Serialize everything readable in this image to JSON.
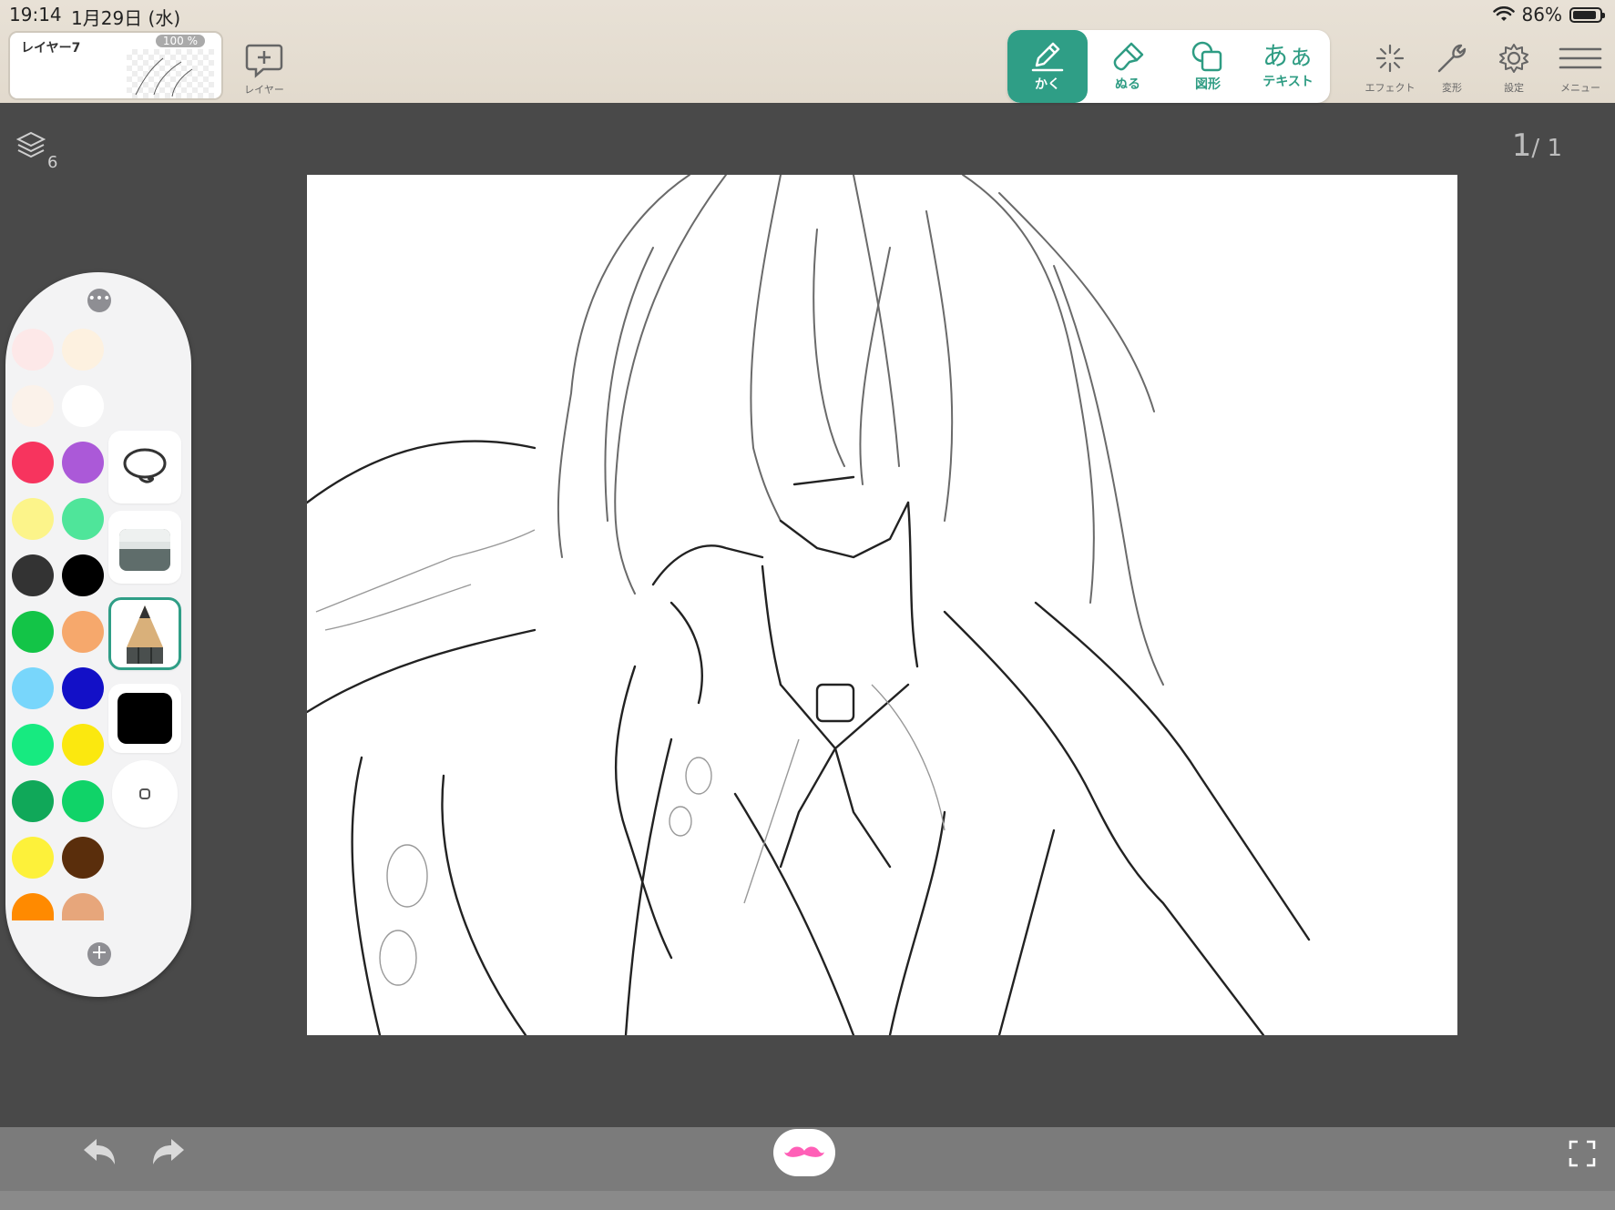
{
  "status": {
    "time": "19:14",
    "date": "1月29日 (水)",
    "battery": "86%"
  },
  "layer": {
    "name": "レイヤー7",
    "opacity": "100 %",
    "add_label": "レイヤー"
  },
  "tools": [
    {
      "label": "かく",
      "active": true
    },
    {
      "label": "ぬる",
      "active": false
    },
    {
      "label": "図形",
      "active": false
    },
    {
      "label": "テキスト",
      "active": false,
      "glyph": "あぁ"
    }
  ],
  "right_tools": {
    "effect": "エフェクト",
    "transform": "変形",
    "settings": "設定",
    "menu": "メニュー"
  },
  "workspace": {
    "layers_count": "6",
    "page_current": "1",
    "page_total": "1"
  },
  "palette": {
    "more": "•••",
    "add": "+",
    "swatches": [
      "#fde8e8",
      "#fdf1e0",
      "#fbf2ea",
      "#ffffff",
      "#f7345e",
      "#ab59d8",
      "#fcf48a",
      "#4fe59a",
      "#333333",
      "#000000",
      "#13c447",
      "#f6a86c",
      "#78d6fb",
      "#1310c7",
      "#17ea80",
      "#fbe80f",
      "#10a859",
      "#10d368",
      "#fdf13a",
      "#5a2e0c",
      "#ff8a00",
      "#e7a67b"
    ],
    "tools": [
      "lasso-icon",
      "eraser-icon",
      "pencil-icon",
      "current-color",
      "brush-size"
    ],
    "current_color": "#000000"
  },
  "colors": {
    "accent": "#2f9e86",
    "mustache": "#ff5fb7"
  }
}
